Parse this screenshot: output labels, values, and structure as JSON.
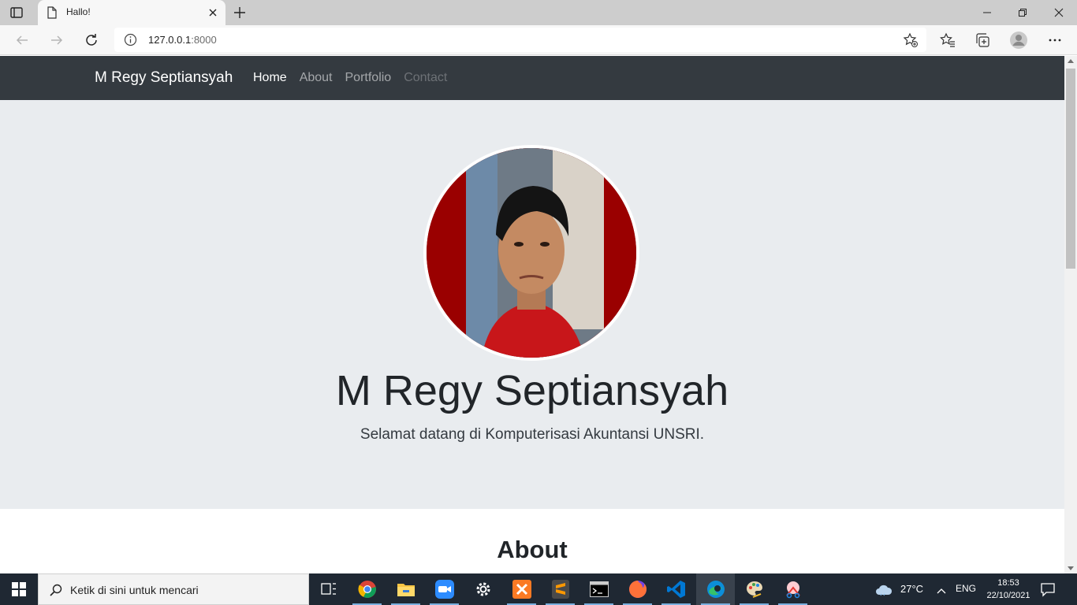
{
  "browser": {
    "tab_title": "Hallo!",
    "url_host": "127.0.0.1",
    "url_port": ":8000"
  },
  "site": {
    "brand": "M Regy Septiansyah",
    "nav": [
      {
        "label": "Home",
        "state": "active"
      },
      {
        "label": "About",
        "state": "normal"
      },
      {
        "label": "Portfolio",
        "state": "normal"
      },
      {
        "label": "Contact",
        "state": "muted"
      }
    ],
    "hero": {
      "name": "M Regy Septiansyah",
      "subtitle": "Selamat datang di Komputerisasi Akuntansi UNSRI."
    },
    "about_heading": "About"
  },
  "taskbar": {
    "search_placeholder": "Ketik di sini untuk mencari",
    "weather": "27°C",
    "language": "ENG",
    "time": "18:53",
    "date": "22/10/2021"
  },
  "colors": {
    "navbar": "#343a40",
    "jumbotron": "#e9ecef",
    "taskbar": "#1f2833"
  }
}
